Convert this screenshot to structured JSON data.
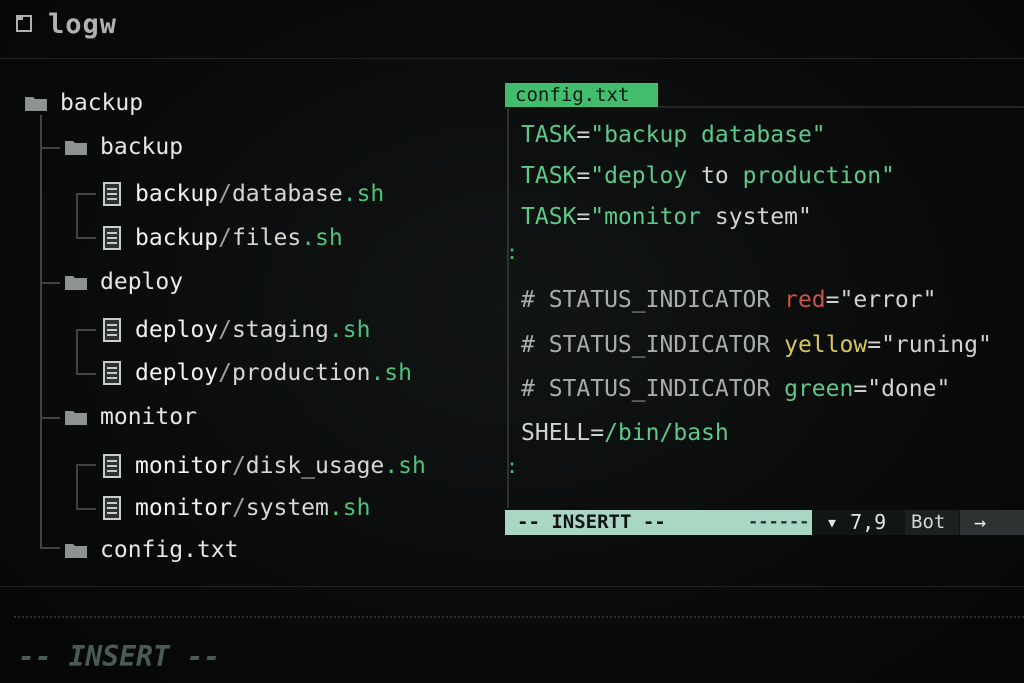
{
  "window": {
    "title": "logw",
    "icon": "folder-icon"
  },
  "tree": {
    "root": "backup",
    "folders": {
      "backup": "backup",
      "deploy": "deploy",
      "monitor": "monitor"
    },
    "files": {
      "backup_database": {
        "dir": "backup",
        "sep": "/",
        "name": "database",
        "ext": ".sh"
      },
      "backup_files": {
        "dir": "backup",
        "sep": "/",
        "name": "files",
        "ext": ".sh"
      },
      "deploy_staging": {
        "dir": "deploy",
        "sep": "/",
        "name": "staging",
        "ext": ".sh"
      },
      "deploy_production": {
        "dir": "deploy",
        "sep": "/",
        "name": "production",
        "ext": ".sh"
      },
      "monitor_disk": {
        "dir": "monitor",
        "sep": "/",
        "name": "disk_usage",
        "ext": ".sh"
      },
      "monitor_system": {
        "dir": "monitor",
        "sep": "/",
        "name": "system",
        "ext": ".sh"
      }
    },
    "config_file": "config.txt"
  },
  "editor": {
    "tab_label": "config.txt",
    "gutter_marker": ":",
    "lines": {
      "l1": {
        "key": "TASK",
        "eq": "=",
        "val": "\"backup database\""
      },
      "l2": {
        "key": "TASK",
        "eq": "=",
        "val_a": "\"deploy",
        "val_b": " to ",
        "val_c": "production\""
      },
      "l3": {
        "key": "TASK",
        "eq": "=",
        "val_a": "\"monitor",
        "val_b": " system\""
      },
      "l4": {
        "comment": "# STATUS_INDICATOR ",
        "color": "red",
        "eq": "=",
        "val": "\"error\""
      },
      "l5": {
        "comment": "# STATUS_INDICATOR ",
        "color": "yellow",
        "eq": "=",
        "val": "\"runing\""
      },
      "l6": {
        "comment": "# STATUS_INDICATOR ",
        "color": "green",
        "eq": "=",
        "val": "\"done\""
      },
      "l7": {
        "key": "SHELL",
        "eq": "=",
        "val": "/bin/bash"
      }
    },
    "status": {
      "mode": "-- INSERTT --",
      "dashes": "------",
      "cursor": "▾ 7,9",
      "scroll": "Bot",
      "arrow": "→"
    }
  },
  "cmdline": {
    "mode": "-- INSERT --"
  },
  "colors": {
    "accent_green": "#41bd6d",
    "status_box": "#aad7c4",
    "red": "#c9524a",
    "yellow": "#d8c65a"
  }
}
